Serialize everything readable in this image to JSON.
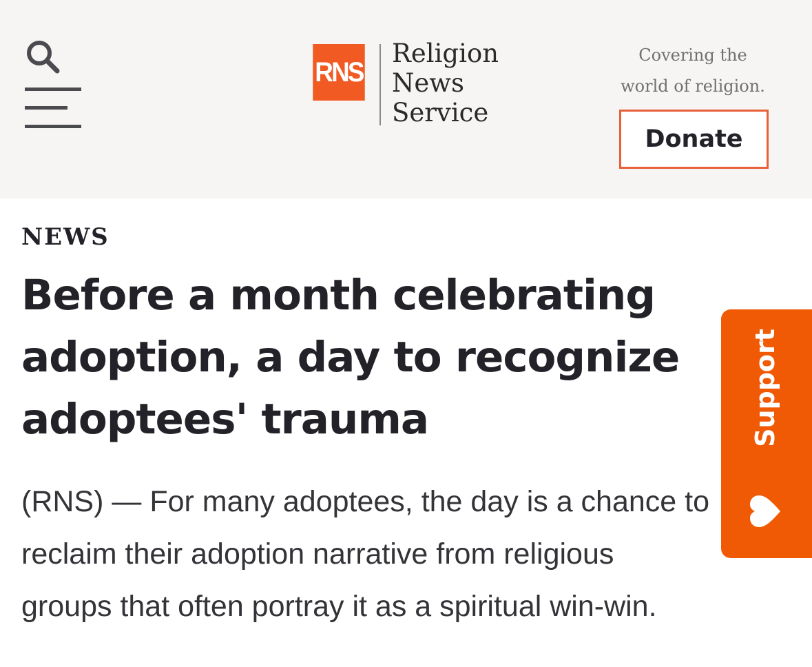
{
  "header": {
    "logo": {
      "mark": "RNS",
      "words": [
        "Religion",
        "News",
        "Service"
      ]
    },
    "tagline": [
      "Covering the",
      "world of religion."
    ],
    "donate_label": "Donate",
    "icons": {
      "search": "search-icon",
      "menu": "hamburger-menu-icon"
    }
  },
  "article": {
    "section": "NEWS",
    "headline_lines": [
      "Before a month celebrating",
      "adoption, a day to recognize",
      "adoptees' trauma"
    ],
    "dek_lines": [
      "(RNS) — For many adoptees, the day is a chance to",
      "reclaim their adoption narrative from religious",
      "groups that often portray it as a spiritual win-win."
    ]
  },
  "support_tab": {
    "label": "Support",
    "icon": "heart-icon"
  },
  "colors": {
    "brand_orange": "#f15a22",
    "support_orange": "#f15a05",
    "header_background": "#f6f5f3",
    "text": "#222228"
  }
}
